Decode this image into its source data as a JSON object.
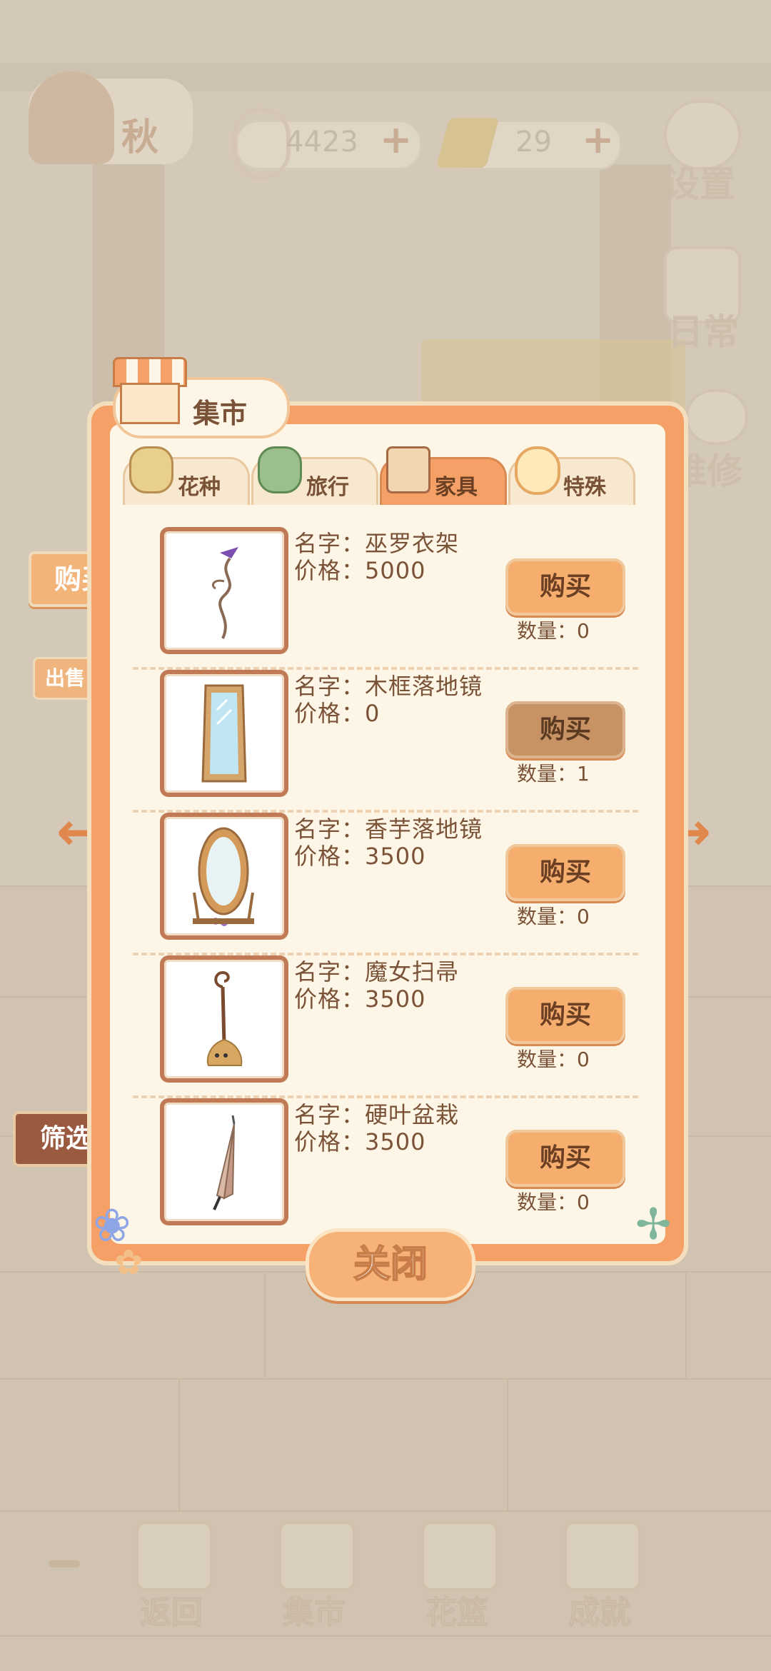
{
  "hud": {
    "season": "秋",
    "fish_count": "4423",
    "cheese_count": "29",
    "settings_label": "设置",
    "daily_label": "日常",
    "repair_label": "维修"
  },
  "market": {
    "title": "集市",
    "tabs": [
      {
        "label": "花种",
        "active": false
      },
      {
        "label": "旅行",
        "active": false
      },
      {
        "label": "家具",
        "active": true
      },
      {
        "label": "特殊",
        "active": false
      }
    ],
    "items": [
      {
        "name_line": "名字：巫罗衣架",
        "price_line": "价格：5000",
        "button": "购买",
        "qty_line": "数量：0",
        "owned": false,
        "icon": "coat-rack-icon"
      },
      {
        "name_line": "名字：木框落地镜",
        "price_line": "价格：0",
        "button": "购买",
        "qty_line": "数量：1",
        "owned": true,
        "icon": "floor-mirror-icon"
      },
      {
        "name_line": "名字：香芋落地镜",
        "price_line": "价格：3500",
        "button": "购买",
        "qty_line": "数量：0",
        "owned": false,
        "icon": "oval-mirror-icon"
      },
      {
        "name_line": "名字：魔女扫帚",
        "price_line": "价格：3500",
        "button": "购买",
        "qty_line": "数量：0",
        "owned": false,
        "icon": "broom-icon"
      },
      {
        "name_line": "名字：硬叶盆栽",
        "price_line": "价格：3500",
        "button": "购买",
        "qty_line": "数量：0",
        "owned": false,
        "icon": "umbrella-icon"
      }
    ],
    "close_label": "关闭"
  },
  "side": {
    "buy": "购买",
    "sell": "出售",
    "filter": "筛选"
  },
  "nav": {
    "items": [
      {
        "label": "返回"
      },
      {
        "label": "集市"
      },
      {
        "label": "花篮"
      },
      {
        "label": "成就"
      }
    ]
  },
  "colors": {
    "panel_orange": "#f4a066",
    "panel_cream": "#fdf6e6",
    "text_brown": "#7a5237",
    "button_orange": "#f6ae6f"
  }
}
